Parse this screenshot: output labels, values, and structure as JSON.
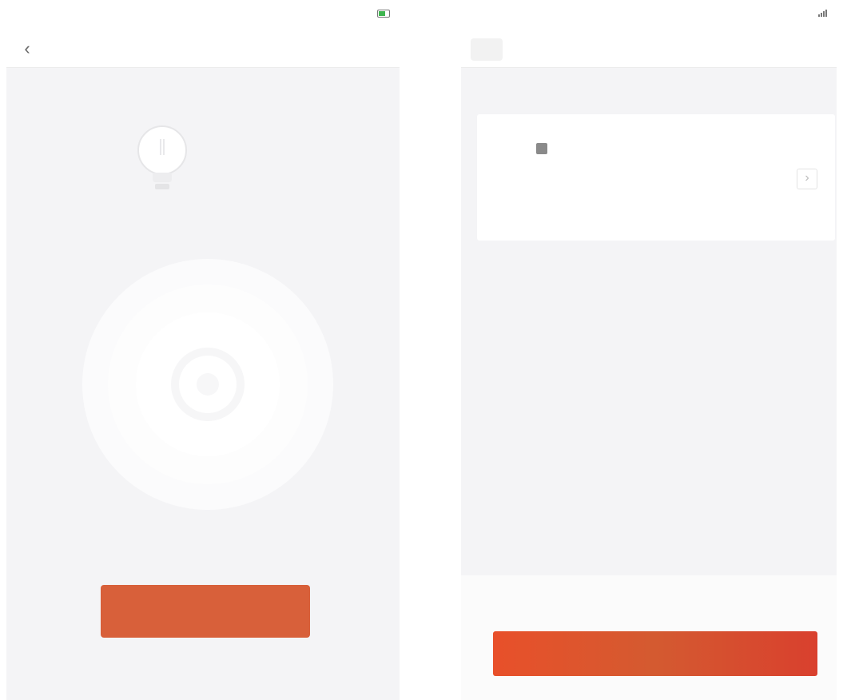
{
  "left_screen": {
    "status": {
      "carrier": "",
      "time": "",
      "battery": ""
    },
    "nav": {
      "back_icon": "back-chevron-icon",
      "title": ""
    },
    "hint": "",
    "device_label": "",
    "done_button": ""
  },
  "right_screen": {
    "status": {
      "carrier": "",
      "time": "",
      "battery": ""
    },
    "nav": {
      "left_button": "",
      "title": "",
      "right": ""
    },
    "section_caption": "",
    "device": {
      "name": "",
      "subtitle": ""
    },
    "confirm_button": ""
  },
  "colors": {
    "accent": "#d8603a",
    "background": "#f4f4f6",
    "battery": "#3fb54f"
  }
}
